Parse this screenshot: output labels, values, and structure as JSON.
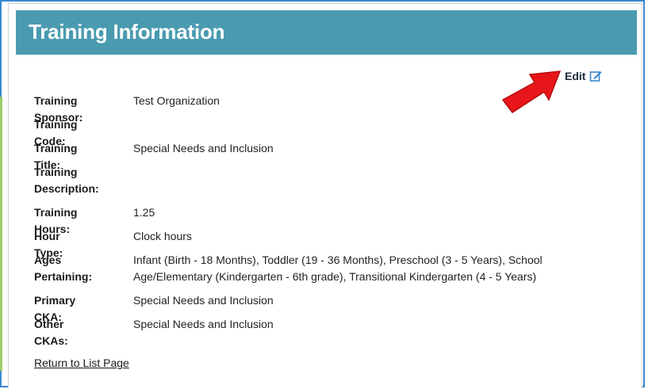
{
  "header": {
    "title": "Training Information"
  },
  "actions": {
    "edit_label": "Edit",
    "edit_icon": "edit-icon"
  },
  "fields": {
    "sponsor": {
      "label": "Training Sponsor:",
      "value": "Test Organization"
    },
    "code": {
      "label": "Training Code:",
      "value": ""
    },
    "title": {
      "label": "Training Title:",
      "value": "Special Needs and Inclusion"
    },
    "description": {
      "label": "Training Description:",
      "value": ""
    },
    "hours": {
      "label": "Training Hours:",
      "value": "1.25"
    },
    "hour_type": {
      "label": "Hour Type:",
      "value": "Clock hours"
    },
    "ages": {
      "label": "Ages Pertaining:",
      "value_line1": "Infant (Birth - 18 Months), Toddler (19 - 36 Months), Preschool (3 - 5 Years), School",
      "value_line2": "Age/Elementary (Kindergarten - 6th grade), Transitional Kindergarten (4 - 5 Years)"
    },
    "primary_cka": {
      "label": "Primary CKA:",
      "value": "Special Needs and Inclusion"
    },
    "other_ckas": {
      "label": "Other CKAs:",
      "value": "Special Needs and Inclusion"
    }
  },
  "footer": {
    "return_label": "Return to List Page"
  },
  "colors": {
    "header_bg": "#4a9bb0",
    "arrow": "#e8161b",
    "frame": "#3a86d0",
    "edit_icon": "#3a86d0"
  }
}
